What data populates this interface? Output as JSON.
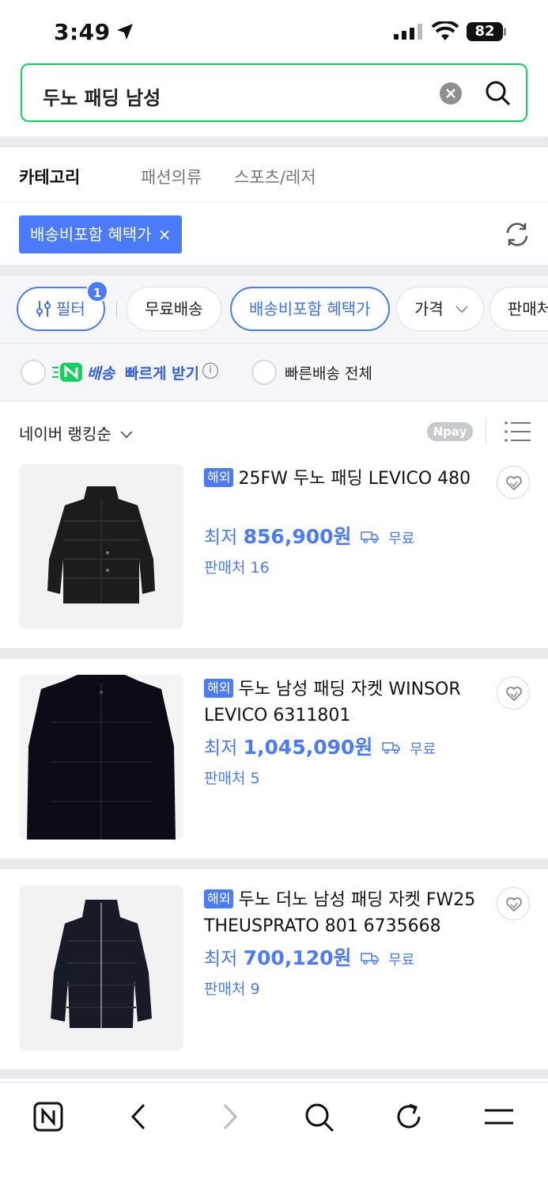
{
  "status": {
    "time": "3:49",
    "battery": "82"
  },
  "search": {
    "query": "두노 패딩 남성"
  },
  "category": {
    "heading": "카테고리",
    "items": [
      "패션의류",
      "스포츠/레저"
    ]
  },
  "applied_filter": {
    "label": "배송비포함 혜택가",
    "remove": "×"
  },
  "filters": {
    "filter_label": "필터",
    "filter_count": "1",
    "free_shipping": "무료배송",
    "shipping_included": "배송비포함 혜택가",
    "price": "가격",
    "seller": "판매처"
  },
  "delivery": {
    "fast_brand": "배송",
    "fast_label": "빠르게 받기",
    "info": "i",
    "all_fast": "빠른배송 전체"
  },
  "sort": {
    "label": "네이버 랭킹순",
    "npay": "Npay"
  },
  "products": [
    {
      "tag": "해외",
      "title": "25FW 두노 패딩 LEVICO 480",
      "price_prefix": "최저",
      "price": "856,900원",
      "shipping": "무료",
      "sellers": "판매처 16"
    },
    {
      "tag": "해외",
      "title": "두노 남성 패딩 자켓 WINSOR LEVICO 6311801",
      "price_prefix": "최저",
      "price": "1,045,090원",
      "shipping": "무료",
      "sellers": "판매처 5"
    },
    {
      "tag": "해외",
      "title": "두노 더노 남성 패딩 자켓 FW25 THEUSPRATO 801 6735668",
      "price_prefix": "최저",
      "price": "700,120원",
      "shipping": "무료",
      "sellers": "판매처 9"
    }
  ],
  "colors": {
    "accent": "#4b7bfa",
    "search_border": "#19ce60",
    "gap": "#e8eaed"
  }
}
